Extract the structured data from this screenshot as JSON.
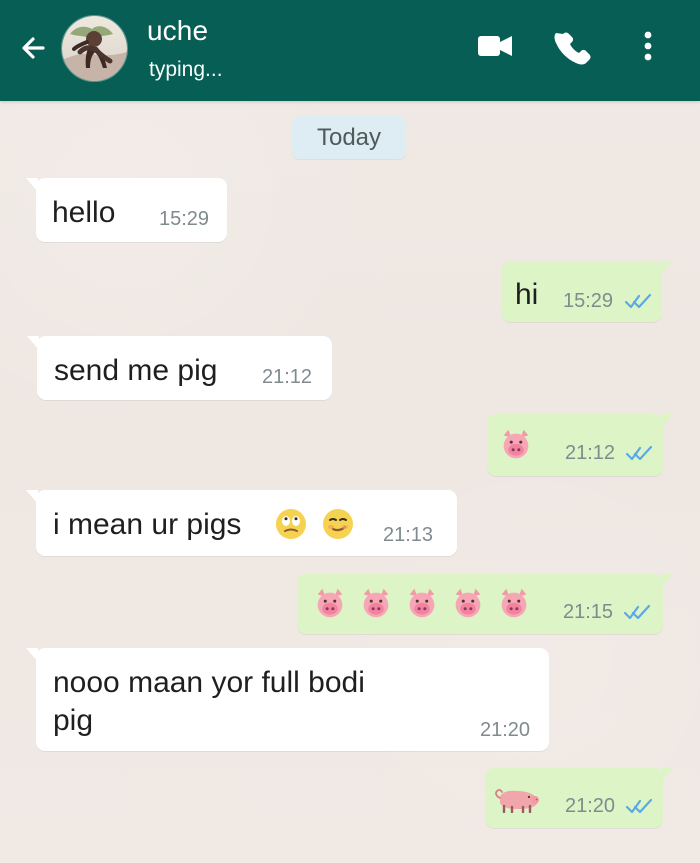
{
  "header": {
    "contact_name": "uche",
    "status": "typing...",
    "icons": {
      "back": "arrow-left-icon",
      "avatar": "avatar-photo",
      "video": "video-camera-icon",
      "phone": "phone-icon",
      "more": "more-vertical-icon"
    }
  },
  "chat": {
    "day_label": "Today",
    "messages": [
      {
        "direction": "incoming",
        "text": "hello",
        "time": "15:29"
      },
      {
        "direction": "outgoing",
        "text": "hi",
        "time": "15:29",
        "status_icon": "double-check-icon"
      },
      {
        "direction": "incoming",
        "text": "send me pig",
        "time": "21:12"
      },
      {
        "direction": "outgoing",
        "emoji": "pig-face-emoji",
        "time": "21:12",
        "status_icon": "double-check-icon"
      },
      {
        "direction": "incoming",
        "text": "i mean ur pigs",
        "emojis": [
          "face-with-rolling-eyes-emoji",
          "smirking-face-emoji"
        ],
        "time": "21:13"
      },
      {
        "direction": "outgoing",
        "emoji_repeat": {
          "name": "pig-face-emoji",
          "count": 5
        },
        "time": "21:15",
        "status_icon": "double-check-icon"
      },
      {
        "direction": "incoming",
        "text_lines": [
          "nooo maan yor full bodi",
          "pig"
        ],
        "time": "21:20"
      },
      {
        "direction": "outgoing",
        "emoji": "pig-emoji",
        "time": "21:20",
        "status_icon": "double-check-icon"
      }
    ]
  },
  "colors": {
    "header": "#075e54",
    "incoming_bubble": "#ffffff",
    "outgoing_bubble": "#ddf5c6",
    "date_chip": "#deedf3",
    "timestamp": "#7f8b8f",
    "receipt": "#5aa9e6"
  }
}
